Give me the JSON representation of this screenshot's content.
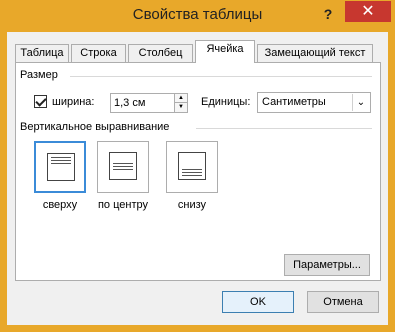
{
  "window": {
    "title": "Свойства таблицы",
    "help": "?",
    "close": "✕"
  },
  "tabs": [
    {
      "label": "Таблица"
    },
    {
      "label": "Строка"
    },
    {
      "label": "Столбец"
    },
    {
      "label": "Ячейка"
    },
    {
      "label": "Замещающий текст"
    }
  ],
  "size": {
    "group_label": "Размер",
    "width_checkbox_label": "ширина:",
    "width_checked": true,
    "width_value": "1,3 см",
    "units_label": "Единицы:",
    "units_value": "Сантиметры"
  },
  "valign": {
    "group_label": "Вертикальное выравнивание",
    "options": [
      {
        "label": "сверху",
        "selected": true
      },
      {
        "label": "по центру",
        "selected": false
      },
      {
        "label": "снизу",
        "selected": false
      }
    ]
  },
  "buttons": {
    "params": "Параметры...",
    "ok": "OK",
    "cancel": "Отмена"
  },
  "colors": {
    "frame": "#e8a82a",
    "close": "#c7372f",
    "selection": "#3b8bd8"
  }
}
